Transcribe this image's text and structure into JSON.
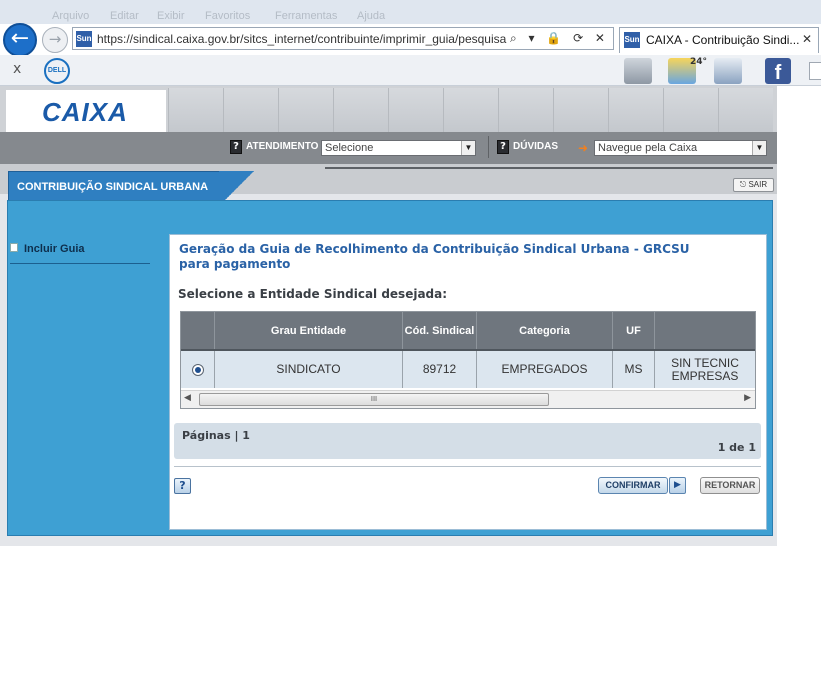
{
  "browser": {
    "url": "https://sindical.caixa.gov.br/sitcs_internet/contribuinte/imprimir_guia/pesquisa",
    "favicon_text": "Sun",
    "address_icons": "⌕ ▾ 🔒 ⟳ ✕",
    "tab_title": "CAIXA - Contribuição Sindi...",
    "tab_close": "✕",
    "menubar": [
      "Arquivo",
      "Editar",
      "Exibir",
      "Favoritos",
      "Ferramentas",
      "Ajuda"
    ],
    "toolbar_close": "x",
    "dell_logo": "DELL",
    "weather_temp": "24°",
    "facebook_glyph": "f"
  },
  "header": {
    "logo_text": "CAIXA",
    "atendimento_label": "ATENDIMENTO",
    "atendimento_select": "Selecione",
    "duvidas_label": "DÚVIDAS",
    "navegue_select": "Navegue pela Caixa",
    "help_glyph": "?"
  },
  "section": {
    "tab_label": "CONTRIBUIÇÃO SINDICAL URBANA",
    "sair_label": "SAIR"
  },
  "sidebar": {
    "items": [
      {
        "label": "Incluir Guia"
      }
    ]
  },
  "main": {
    "title": "Geração da Guia de Recolhimento da Contribuição Sindical Urbana - GRCSU para pagamento",
    "subtitle": "Selecione a Entidade Sindical desejada:",
    "table": {
      "headers": [
        "",
        "Grau Entidade",
        "Cód. Sindical",
        "Categoria",
        "UF",
        ""
      ],
      "rows": [
        {
          "selected": true,
          "grau": "SINDICATO",
          "codigo": "89712",
          "categoria": "EMPREGADOS",
          "uf": "MS",
          "nome": "SIN TECNIC EMPRESAS"
        }
      ]
    },
    "scroll_thumb_glyph": "III",
    "pager": {
      "label": "Páginas  |  1",
      "count": "1 de 1"
    },
    "buttons": {
      "help": "?",
      "confirm": "CONFIRMAR",
      "confirm_arrow": "▶",
      "return": "RETORNAR"
    }
  },
  "colors": {
    "brand_blue": "#1a5aa8",
    "frame_blue": "#3ea0d3",
    "title_blue": "#2a62a6",
    "header_gray": "#6f767e"
  }
}
